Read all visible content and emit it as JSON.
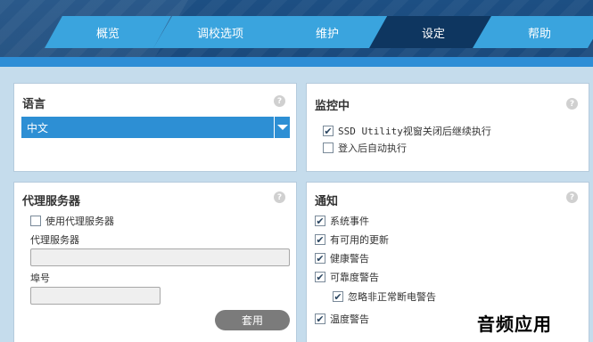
{
  "tabs": [
    {
      "label": "概览",
      "active": false
    },
    {
      "label": "调校选项",
      "active": false
    },
    {
      "label": "维护",
      "active": false
    },
    {
      "label": "设定",
      "active": true
    },
    {
      "label": "帮助",
      "active": false
    }
  ],
  "language": {
    "title": "语言",
    "help": "?",
    "selected": "中文"
  },
  "monitor": {
    "title": "监控中",
    "help": "?",
    "options": [
      {
        "label": "SSD Utility视窗关闭后继续执行",
        "checked": true
      },
      {
        "label": "登入后自动执行",
        "checked": false
      }
    ]
  },
  "proxy": {
    "title": "代理服务器",
    "help": "?",
    "use_proxy_label": "使用代理服务器",
    "use_proxy_checked": false,
    "server_label": "代理服务器",
    "server_value": "",
    "port_label": "埠号",
    "port_value": "",
    "apply_label": "套用"
  },
  "notify": {
    "title": "通知",
    "help": "?",
    "options": [
      {
        "label": "系统事件",
        "checked": true
      },
      {
        "label": "有可用的更新",
        "checked": true
      },
      {
        "label": "健康警告",
        "checked": true
      },
      {
        "label": "可靠度警告",
        "checked": true
      },
      {
        "label": "忽略非正常断电警告",
        "checked": true
      },
      {
        "label": "温度警告",
        "checked": true
      }
    ]
  },
  "watermark": "音频应用",
  "colors": {
    "header": "#1d4f83",
    "tab_inactive": "#3aa4de",
    "tab_active": "#0e3660",
    "accent": "#2e8ed6",
    "background": "#c5dcec"
  }
}
